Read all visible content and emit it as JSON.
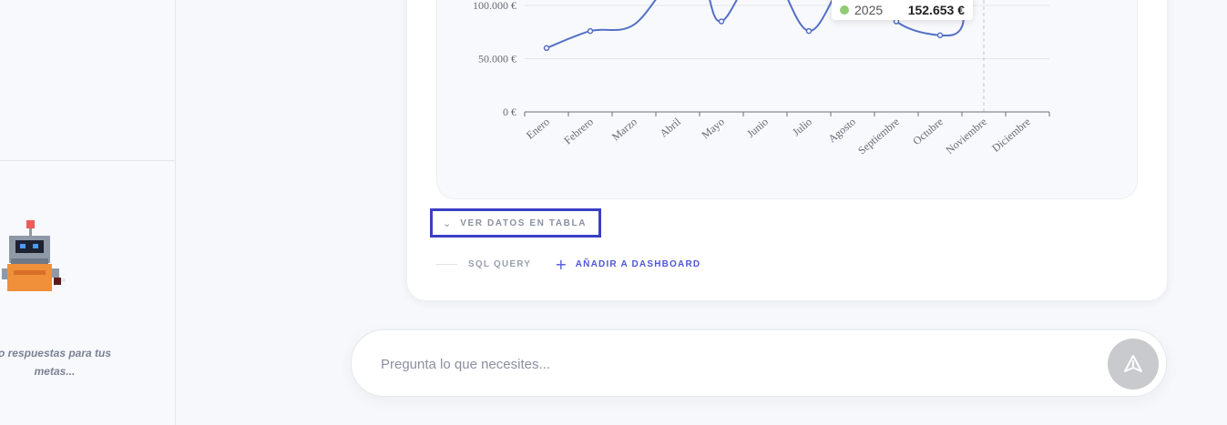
{
  "sidebar": {
    "tip_line1": "o respuestas para tus",
    "tip_line2": "metas..."
  },
  "chart_data": {
    "type": "line",
    "categories": [
      "Enero",
      "Febrero",
      "Marzo",
      "Abril",
      "Mayo",
      "Junio",
      "Julio",
      "Agosto",
      "Septiembre",
      "Octubre",
      "Noviembre",
      "Diciembre"
    ],
    "series": [
      {
        "name": "2025",
        "values": [
          60000,
          76000,
          null,
          null,
          85000,
          null,
          76000,
          null,
          85000,
          72000,
          null,
          null
        ]
      }
    ],
    "y_ticks": [
      "0 €",
      "50.000 €",
      "100.000 €"
    ],
    "ylim": [
      0,
      100000
    ],
    "tooltip": {
      "series": "2025",
      "value": "152.653 €"
    }
  },
  "colors": {
    "line": "#5470c6",
    "accent": "#4f56d8",
    "highlight_border": "#3b3fc4"
  },
  "actions": {
    "ver_datos_label": "VER DATOS EN TABLA",
    "sql_label": "SQL QUERY",
    "add_dashboard_label": "AÑADIR A DASHBOARD"
  },
  "chat_input": {
    "placeholder": "Pregunta lo que necesites...",
    "value": ""
  },
  "icons": {
    "chevron": "chevron-down-icon",
    "plus": "plus-icon",
    "send": "send-icon"
  }
}
